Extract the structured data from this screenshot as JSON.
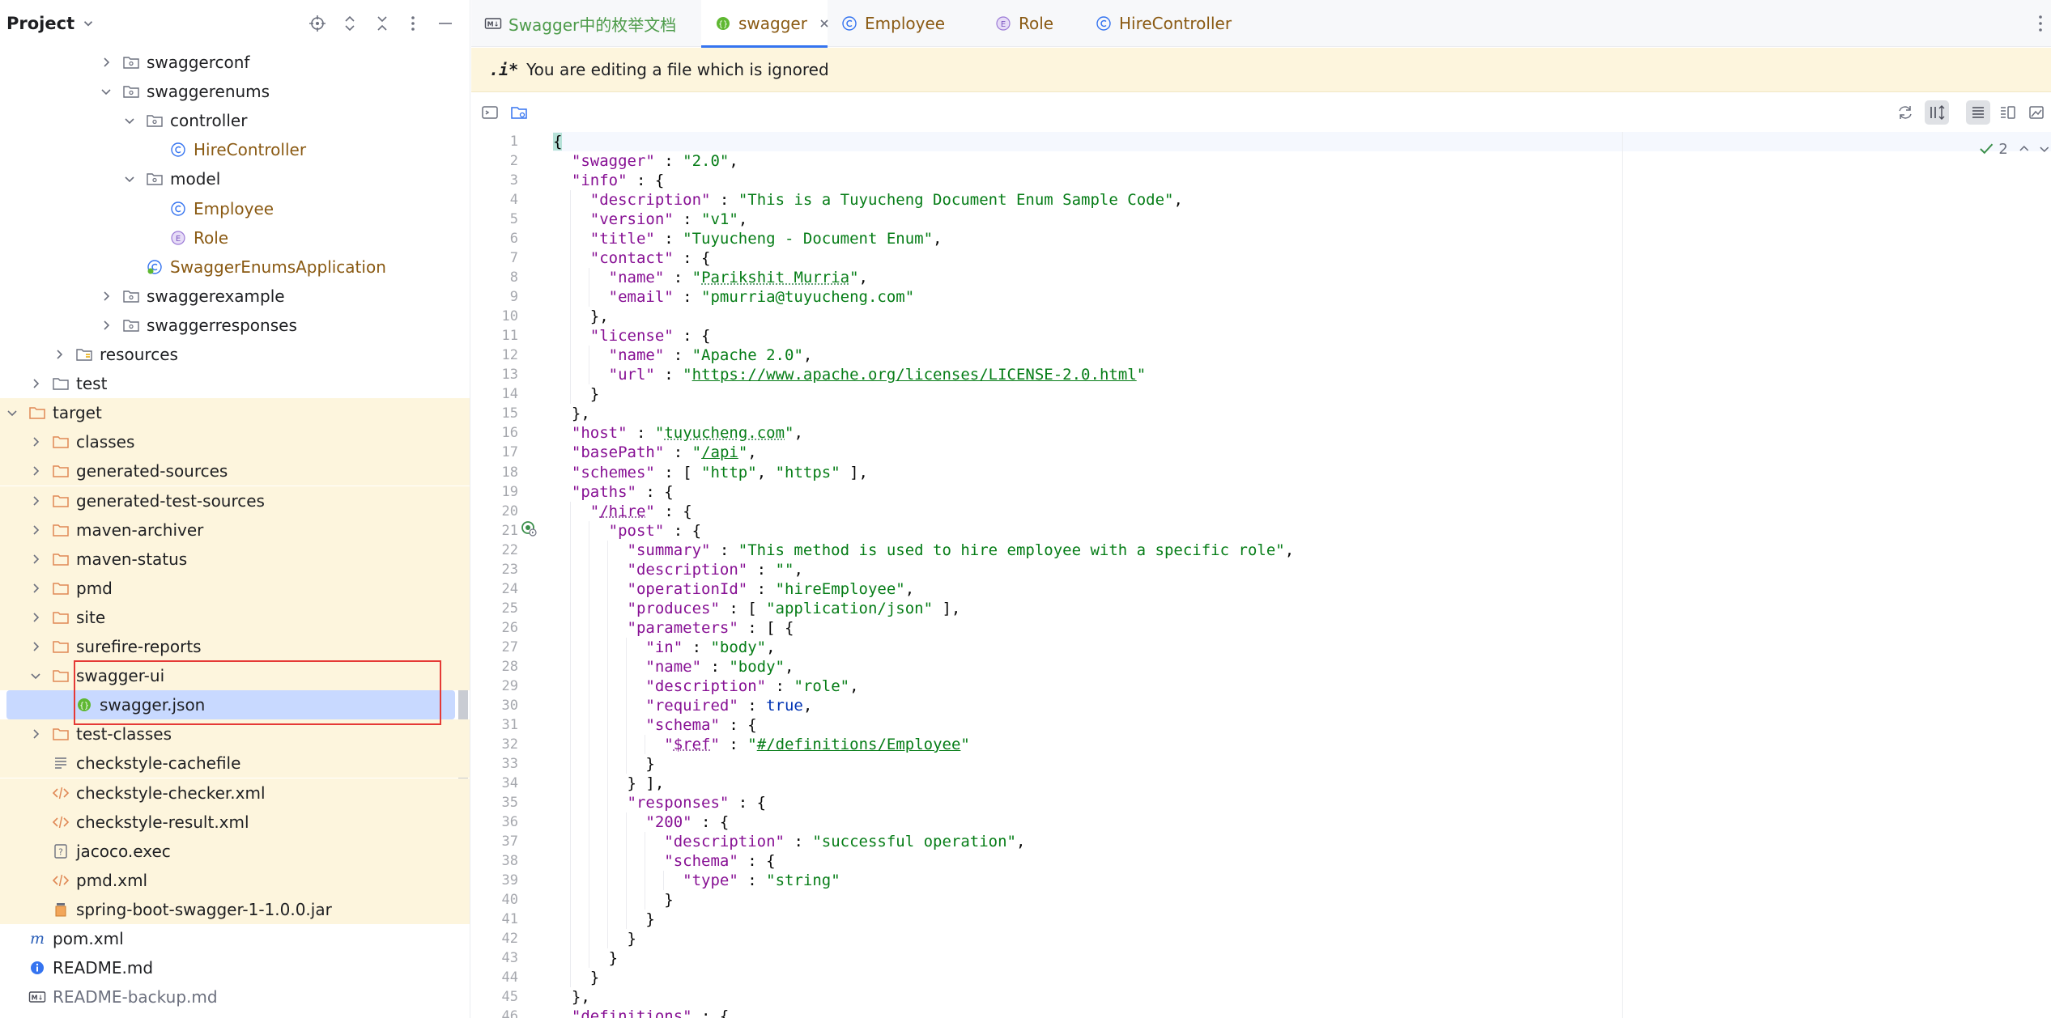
{
  "project_panel": {
    "title": "Project",
    "tree": [
      {
        "label": "swaggerconf",
        "icon": "package-folder-icon",
        "color": "dark",
        "chevron": "right",
        "depth": 7
      },
      {
        "label": "swaggerenums",
        "icon": "package-folder-icon",
        "color": "dark",
        "chevron": "down",
        "depth": 7
      },
      {
        "label": "controller",
        "icon": "package-folder-icon",
        "color": "dark",
        "chevron": "down",
        "depth": 8
      },
      {
        "label": "HireController",
        "icon": "class-icon",
        "color": "brown",
        "chevron": "",
        "depth": 9
      },
      {
        "label": "model",
        "icon": "package-folder-icon",
        "color": "dark",
        "chevron": "down",
        "depth": 8
      },
      {
        "label": "Employee",
        "icon": "class-icon",
        "color": "brown",
        "chevron": "",
        "depth": 9
      },
      {
        "label": "Role",
        "icon": "enum-icon",
        "color": "brown",
        "chevron": "",
        "depth": 9
      },
      {
        "label": "SwaggerEnumsApplication",
        "icon": "spring-boot-class-icon",
        "color": "brown",
        "chevron": "",
        "depth": 8
      },
      {
        "label": "swaggerexample",
        "icon": "package-folder-icon",
        "color": "dark",
        "chevron": "right",
        "depth": 7
      },
      {
        "label": "swaggerresponses",
        "icon": "package-folder-icon",
        "color": "dark",
        "chevron": "right",
        "depth": 7
      },
      {
        "label": "resources",
        "icon": "resources-folder-icon",
        "color": "dark",
        "chevron": "right",
        "depth": 5
      },
      {
        "label": "test",
        "icon": "folder-icon",
        "color": "dark",
        "chevron": "right",
        "depth": 4
      },
      {
        "label": "target",
        "icon": "excluded-folder-icon",
        "color": "dark",
        "chevron": "down",
        "depth": 3,
        "ignored": true
      },
      {
        "label": "classes",
        "icon": "excluded-folder-icon",
        "color": "dark",
        "chevron": "right",
        "depth": 4,
        "ignored": true
      },
      {
        "label": "generated-sources",
        "icon": "excluded-folder-icon",
        "color": "dark",
        "chevron": "right",
        "depth": 4,
        "ignored": true
      },
      {
        "label": "generated-test-sources",
        "icon": "excluded-folder-icon",
        "color": "dark",
        "chevron": "right",
        "depth": 4,
        "ignored": true
      },
      {
        "label": "maven-archiver",
        "icon": "excluded-folder-icon",
        "color": "dark",
        "chevron": "right",
        "depth": 4,
        "ignored": true
      },
      {
        "label": "maven-status",
        "icon": "excluded-folder-icon",
        "color": "dark",
        "chevron": "right",
        "depth": 4,
        "ignored": true
      },
      {
        "label": "pmd",
        "icon": "excluded-folder-icon",
        "color": "dark",
        "chevron": "right",
        "depth": 4,
        "ignored": true
      },
      {
        "label": "site",
        "icon": "excluded-folder-icon",
        "color": "dark",
        "chevron": "right",
        "depth": 4,
        "ignored": true
      },
      {
        "label": "surefire-reports",
        "icon": "excluded-folder-icon",
        "color": "dark",
        "chevron": "right",
        "depth": 4,
        "ignored": true
      },
      {
        "label": "swagger-ui",
        "icon": "excluded-folder-icon",
        "color": "dark",
        "chevron": "down",
        "depth": 4,
        "ignored": true
      },
      {
        "label": "swagger.json",
        "icon": "json-file-icon",
        "color": "dark",
        "chevron": "",
        "depth": 5,
        "ignored": true,
        "selected": true
      },
      {
        "label": "test-classes",
        "icon": "excluded-folder-icon",
        "color": "dark",
        "chevron": "right",
        "depth": 4,
        "ignored": true
      },
      {
        "label": "checkstyle-cachefile",
        "icon": "text-file-icon",
        "color": "dark",
        "chevron": "",
        "depth": 4,
        "ignored": true
      },
      {
        "label": "checkstyle-checker.xml",
        "icon": "xml-file-icon",
        "color": "dark",
        "chevron": "",
        "depth": 4,
        "ignored": true
      },
      {
        "label": "checkstyle-result.xml",
        "icon": "xml-file-icon",
        "color": "dark",
        "chevron": "",
        "depth": 4,
        "ignored": true
      },
      {
        "label": "jacoco.exec",
        "icon": "unknown-file-icon",
        "color": "dark",
        "chevron": "",
        "depth": 4,
        "ignored": true
      },
      {
        "label": "pmd.xml",
        "icon": "xml-file-icon",
        "color": "dark",
        "chevron": "",
        "depth": 4,
        "ignored": true
      },
      {
        "label": "spring-boot-swagger-1-1.0.0.jar",
        "icon": "jar-file-icon",
        "color": "dark",
        "chevron": "",
        "depth": 4,
        "ignored": true
      },
      {
        "label": "pom.xml",
        "icon": "maven-icon",
        "color": "dark",
        "chevron": "",
        "depth": 3
      },
      {
        "label": "README.md",
        "icon": "info-file-icon",
        "color": "dark",
        "chevron": "",
        "depth": 3
      },
      {
        "label": "README-backup.md",
        "icon": "markdown-file-icon",
        "color": "gray",
        "chevron": "",
        "depth": 3
      }
    ]
  },
  "tabs": [
    {
      "label": "Swagger中的枚举文档",
      "icon": "markdown-file-icon",
      "color": "#4d9b4a",
      "active": false,
      "closable": false
    },
    {
      "label": "swagger",
      "icon": "json-file-icon",
      "color": "#8a5a13",
      "active": true,
      "closable": true
    },
    {
      "label": "Employee",
      "icon": "class-icon",
      "color": "#8a5a13",
      "active": false,
      "closable": false
    },
    {
      "label": "Role",
      "icon": "enum-icon",
      "color": "#8a5a13",
      "active": false,
      "closable": false
    },
    {
      "label": "HireController",
      "icon": "class-icon",
      "color": "#8a5a13",
      "active": false,
      "closable": false
    }
  ],
  "banner": {
    "icon": ".i*",
    "text": "You are editing a file which is ignored"
  },
  "editor": {
    "inspection_count": "2",
    "lines": [
      [
        [
          "brace-match",
          "{"
        ]
      ],
      [
        [
          "punc",
          "  "
        ],
        [
          "key",
          "\"swagger\""
        ],
        [
          "punc",
          " : "
        ],
        [
          "str",
          "\"2.0\""
        ],
        [
          "punc",
          ","
        ]
      ],
      [
        [
          "punc",
          "  "
        ],
        [
          "key",
          "\"info\""
        ],
        [
          "punc",
          " : {"
        ]
      ],
      [
        [
          "punc",
          "    "
        ],
        [
          "key",
          "\"description\""
        ],
        [
          "punc",
          " : "
        ],
        [
          "str",
          "\"This is a Tuyucheng Document Enum Sample Code\""
        ],
        [
          "punc",
          ","
        ]
      ],
      [
        [
          "punc",
          "    "
        ],
        [
          "key",
          "\"version\""
        ],
        [
          "punc",
          " : "
        ],
        [
          "str",
          "\"v1\""
        ],
        [
          "punc",
          ","
        ]
      ],
      [
        [
          "punc",
          "    "
        ],
        [
          "key",
          "\"title\""
        ],
        [
          "punc",
          " : "
        ],
        [
          "str",
          "\"Tuyucheng - Document Enum\""
        ],
        [
          "punc",
          ","
        ]
      ],
      [
        [
          "punc",
          "    "
        ],
        [
          "key",
          "\"contact\""
        ],
        [
          "punc",
          " : {"
        ]
      ],
      [
        [
          "punc",
          "      "
        ],
        [
          "key",
          "\"name\""
        ],
        [
          "punc",
          " : "
        ],
        [
          "str",
          "\""
        ],
        [
          "wav",
          "Parikshit Murria"
        ],
        [
          "str",
          "\""
        ],
        [
          "punc",
          ","
        ]
      ],
      [
        [
          "punc",
          "      "
        ],
        [
          "key",
          "\"email\""
        ],
        [
          "punc",
          " : "
        ],
        [
          "str",
          "\"pmurria@tuyucheng.com\""
        ]
      ],
      [
        [
          "punc",
          "    },"
        ]
      ],
      [
        [
          "punc",
          "    "
        ],
        [
          "key",
          "\"license\""
        ],
        [
          "punc",
          " : {"
        ]
      ],
      [
        [
          "punc",
          "      "
        ],
        [
          "key",
          "\"name\""
        ],
        [
          "punc",
          " : "
        ],
        [
          "str",
          "\"Apache 2.0\""
        ],
        [
          "punc",
          ","
        ]
      ],
      [
        [
          "punc",
          "      "
        ],
        [
          "key",
          "\"url\""
        ],
        [
          "punc",
          " : "
        ],
        [
          "str",
          "\""
        ],
        [
          "link",
          "https://www.apache.org/licenses/LICENSE-2.0.html"
        ],
        [
          "str",
          "\""
        ]
      ],
      [
        [
          "punc",
          "    }"
        ]
      ],
      [
        [
          "punc",
          "  },"
        ]
      ],
      [
        [
          "punc",
          "  "
        ],
        [
          "key",
          "\"host\""
        ],
        [
          "punc",
          " : "
        ],
        [
          "str",
          "\""
        ],
        [
          "wav",
          "tuyucheng.com"
        ],
        [
          "str",
          "\""
        ],
        [
          "punc",
          ","
        ]
      ],
      [
        [
          "punc",
          "  "
        ],
        [
          "key",
          "\"basePath\""
        ],
        [
          "punc",
          " : "
        ],
        [
          "str",
          "\""
        ],
        [
          "link",
          "/api"
        ],
        [
          "str",
          "\""
        ],
        [
          "punc",
          ","
        ]
      ],
      [
        [
          "punc",
          "  "
        ],
        [
          "key",
          "\"schemes\""
        ],
        [
          "punc",
          " : [ "
        ],
        [
          "str",
          "\"http\""
        ],
        [
          "punc",
          ", "
        ],
        [
          "str",
          "\"https\""
        ],
        [
          "punc",
          " ],"
        ]
      ],
      [
        [
          "punc",
          "  "
        ],
        [
          "key",
          "\"paths\""
        ],
        [
          "punc",
          " : {"
        ]
      ],
      [
        [
          "punc",
          "    "
        ],
        [
          "key",
          "\""
        ],
        [
          "keyref",
          "/hire"
        ],
        [
          "key",
          "\""
        ],
        [
          "punc",
          " : {"
        ]
      ],
      [
        [
          "punc",
          "      "
        ],
        [
          "key",
          "\"post\""
        ],
        [
          "punc",
          " : {"
        ]
      ],
      [
        [
          "punc",
          "        "
        ],
        [
          "key",
          "\"summary\""
        ],
        [
          "punc",
          " : "
        ],
        [
          "str",
          "\"This method is used to hire employee with a specific role\""
        ],
        [
          "punc",
          ","
        ]
      ],
      [
        [
          "punc",
          "        "
        ],
        [
          "key",
          "\"description\""
        ],
        [
          "punc",
          " : "
        ],
        [
          "str",
          "\"\""
        ],
        [
          "punc",
          ","
        ]
      ],
      [
        [
          "punc",
          "        "
        ],
        [
          "key",
          "\"operationId\""
        ],
        [
          "punc",
          " : "
        ],
        [
          "str",
          "\"hireEmployee\""
        ],
        [
          "punc",
          ","
        ]
      ],
      [
        [
          "punc",
          "        "
        ],
        [
          "key",
          "\"produces\""
        ],
        [
          "punc",
          " : [ "
        ],
        [
          "str",
          "\"application/json\""
        ],
        [
          "punc",
          " ],"
        ]
      ],
      [
        [
          "punc",
          "        "
        ],
        [
          "key",
          "\"parameters\""
        ],
        [
          "punc",
          " : [ {"
        ]
      ],
      [
        [
          "punc",
          "          "
        ],
        [
          "key",
          "\"in\""
        ],
        [
          "punc",
          " : "
        ],
        [
          "str",
          "\"body\""
        ],
        [
          "punc",
          ","
        ]
      ],
      [
        [
          "punc",
          "          "
        ],
        [
          "key",
          "\"name\""
        ],
        [
          "punc",
          " : "
        ],
        [
          "str",
          "\"body\""
        ],
        [
          "punc",
          ","
        ]
      ],
      [
        [
          "punc",
          "          "
        ],
        [
          "key",
          "\"description\""
        ],
        [
          "punc",
          " : "
        ],
        [
          "str",
          "\"role\""
        ],
        [
          "punc",
          ","
        ]
      ],
      [
        [
          "punc",
          "          "
        ],
        [
          "key",
          "\"required\""
        ],
        [
          "punc",
          " : "
        ],
        [
          "kw",
          "true"
        ],
        [
          "punc",
          ","
        ]
      ],
      [
        [
          "punc",
          "          "
        ],
        [
          "key",
          "\"schema\""
        ],
        [
          "punc",
          " : {"
        ]
      ],
      [
        [
          "punc",
          "            "
        ],
        [
          "key",
          "\""
        ],
        [
          "keyref",
          "$ref"
        ],
        [
          "key",
          "\""
        ],
        [
          "punc",
          " : "
        ],
        [
          "str",
          "\""
        ],
        [
          "link",
          "#/definitions/Employee"
        ],
        [
          "str",
          "\""
        ]
      ],
      [
        [
          "punc",
          "          }"
        ]
      ],
      [
        [
          "punc",
          "        } ],"
        ]
      ],
      [
        [
          "punc",
          "        "
        ],
        [
          "key",
          "\"responses\""
        ],
        [
          "punc",
          " : {"
        ]
      ],
      [
        [
          "punc",
          "          "
        ],
        [
          "key",
          "\"200\""
        ],
        [
          "punc",
          " : {"
        ]
      ],
      [
        [
          "punc",
          "            "
        ],
        [
          "key",
          "\"description\""
        ],
        [
          "punc",
          " : "
        ],
        [
          "str",
          "\"successful operation\""
        ],
        [
          "punc",
          ","
        ]
      ],
      [
        [
          "punc",
          "            "
        ],
        [
          "key",
          "\"schema\""
        ],
        [
          "punc",
          " : {"
        ]
      ],
      [
        [
          "punc",
          "              "
        ],
        [
          "key",
          "\"type\""
        ],
        [
          "punc",
          " : "
        ],
        [
          "str",
          "\"string\""
        ]
      ],
      [
        [
          "punc",
          "            }"
        ]
      ],
      [
        [
          "punc",
          "          }"
        ]
      ],
      [
        [
          "punc",
          "        }"
        ]
      ],
      [
        [
          "punc",
          "      }"
        ]
      ],
      [
        [
          "punc",
          "    }"
        ]
      ],
      [
        [
          "punc",
          "  },"
        ]
      ],
      [
        [
          "punc",
          "  "
        ],
        [
          "key",
          "\"definitions\""
        ],
        [
          "punc",
          " : {"
        ]
      ]
    ]
  }
}
